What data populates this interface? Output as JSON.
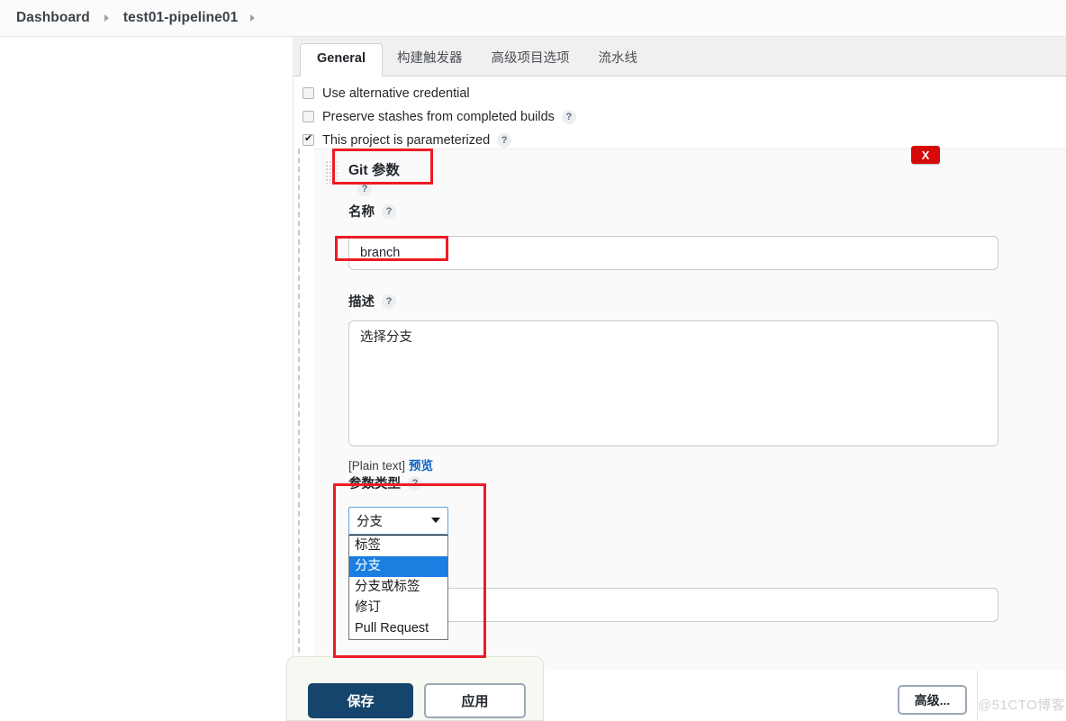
{
  "breadcrumb": {
    "items": [
      {
        "label": "Dashboard"
      },
      {
        "label": "test01-pipeline01"
      }
    ]
  },
  "tabs": [
    {
      "label": "General",
      "active": true
    },
    {
      "label": "构建触发器",
      "active": false
    },
    {
      "label": "高级项目选项",
      "active": false
    },
    {
      "label": "流水线",
      "active": false
    }
  ],
  "checkboxes": [
    {
      "label": "Use alternative credential",
      "checked": false,
      "help": false
    },
    {
      "label": "Preserve stashes from completed builds",
      "checked": false,
      "help": true
    },
    {
      "label": "This project is parameterized",
      "checked": true,
      "help": true
    }
  ],
  "parameter": {
    "title": "Git 参数",
    "delete_label": "X",
    "name_label": "名称",
    "name_value": "branch",
    "description_label": "描述",
    "description_value": "选择分支",
    "plain_text_label": "[Plain text]",
    "preview_link": "预览",
    "type_label": "参数类型",
    "type_selected": "分支",
    "type_options": [
      {
        "label": "标签",
        "selected": false
      },
      {
        "label": "分支",
        "selected": true
      },
      {
        "label": "分支或标签",
        "selected": false
      },
      {
        "label": "修订",
        "selected": false
      },
      {
        "label": "Pull Request",
        "selected": false
      }
    ],
    "default_value": ""
  },
  "help_glyph": "?",
  "footer": {
    "save_label": "保存",
    "apply_label": "应用",
    "advanced_label": "高级..."
  },
  "watermark": "@51CTO博客",
  "colors": {
    "save_bg": "#15456c",
    "delete_bg": "#d70a0a",
    "annotation": "#ec1c24",
    "select_highlight": "#1a7fe0",
    "link": "#0b64c4"
  }
}
